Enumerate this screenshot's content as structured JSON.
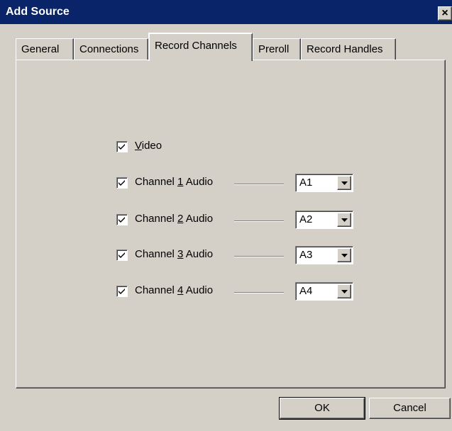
{
  "window": {
    "title": "Add Source",
    "close_glyph": "×"
  },
  "tabs": [
    {
      "label": "General",
      "active": false
    },
    {
      "label": "Connections",
      "active": false
    },
    {
      "label": "Record Channels",
      "active": true
    },
    {
      "label": "Preroll",
      "active": false
    },
    {
      "label": "Record Handles",
      "active": false
    }
  ],
  "record_channels": {
    "video": {
      "label_pre": "",
      "mnemonic": "V",
      "label_post": "ideo",
      "checked": true
    },
    "channels": [
      {
        "label_pre": "Channel ",
        "mnemonic": "1",
        "label_post": " Audio",
        "checked": true,
        "track": "A1"
      },
      {
        "label_pre": "Channel ",
        "mnemonic": "2",
        "label_post": " Audio",
        "checked": true,
        "track": "A2"
      },
      {
        "label_pre": "Channel ",
        "mnemonic": "3",
        "label_post": " Audio",
        "checked": true,
        "track": "A3"
      },
      {
        "label_pre": "Channel ",
        "mnemonic": "4",
        "label_post": " Audio",
        "checked": true,
        "track": "A4"
      }
    ]
  },
  "buttons": {
    "ok": "OK",
    "cancel": "Cancel"
  },
  "icons": {
    "checkmark": "checkmark-icon",
    "dropdown": "chevron-down-icon",
    "close": "close-icon"
  }
}
